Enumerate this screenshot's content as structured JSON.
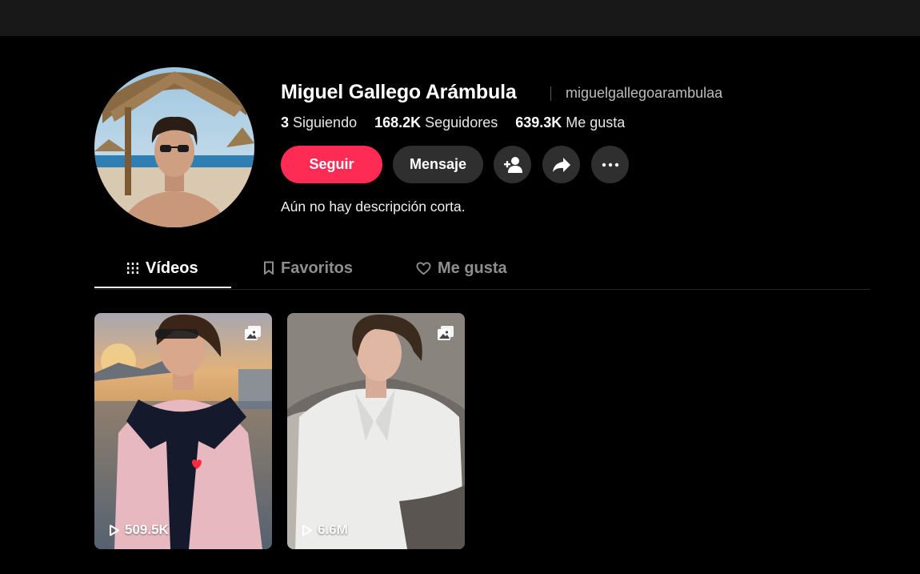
{
  "profile": {
    "display_name": "Miguel Gallego Arámbula",
    "username": "miguelgallegoarambulaa",
    "bio": "Aún no hay descripción corta."
  },
  "stats": {
    "following_count": "3",
    "following_label": "Siguiendo",
    "followers_count": "168.2K",
    "followers_label": "Seguidores",
    "likes_count": "639.3K",
    "likes_label": "Me gusta"
  },
  "actions": {
    "follow_label": "Seguir",
    "message_label": "Mensaje",
    "add_friend_icon": "add-user-icon",
    "share_icon": "share-icon",
    "more_icon": "more-icon"
  },
  "tabs": [
    {
      "label": "Vídeos",
      "icon": "grid-icon",
      "active": true
    },
    {
      "label": "Favoritos",
      "icon": "bookmark-icon",
      "active": false
    },
    {
      "label": "Me gusta",
      "icon": "heart-icon",
      "active": false
    }
  ],
  "videos": [
    {
      "views": "509.5K",
      "type_icon": "photo-gallery-icon"
    },
    {
      "views": "6.6M",
      "type_icon": "photo-gallery-icon"
    }
  ],
  "colors": {
    "accent": "#fe2c55",
    "background": "#000000",
    "button_secondary": "#2f2f2f"
  }
}
